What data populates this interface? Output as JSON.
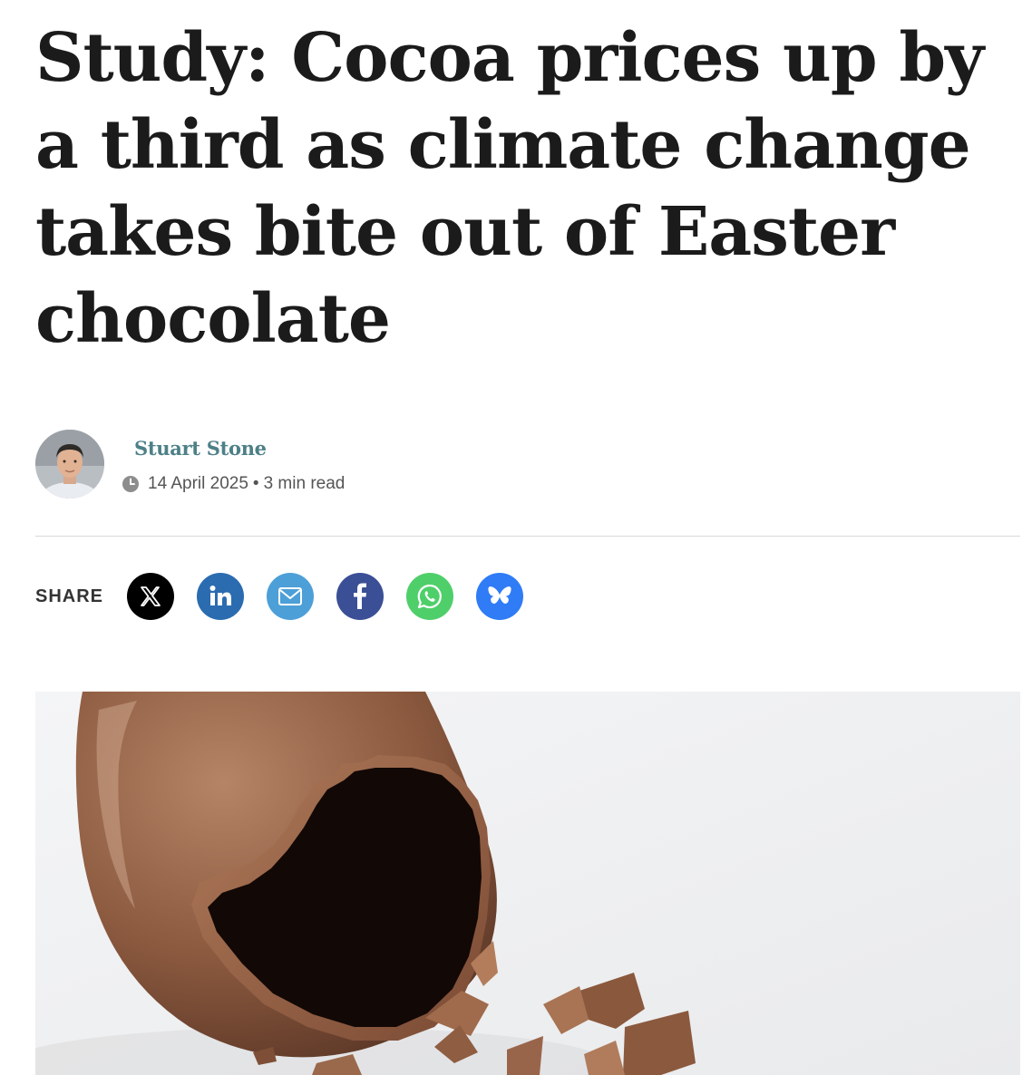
{
  "article": {
    "headline": "Study: Cocoa prices up by a third as climate change takes bite out of Easter chocolate"
  },
  "byline": {
    "author": "Stuart Stone",
    "date": "14 April 2025",
    "separator": "•",
    "read_time": "3 min read"
  },
  "share": {
    "label": "SHARE",
    "buttons": [
      {
        "network": "X",
        "icon": "x-icon",
        "color": "#000000"
      },
      {
        "network": "LinkedIn",
        "icon": "linkedin-icon",
        "color": "#2b6cb0"
      },
      {
        "network": "Email",
        "icon": "mail-icon",
        "color": "#4d9fd8"
      },
      {
        "network": "Facebook",
        "icon": "facebook-icon",
        "color": "#3b4f96"
      },
      {
        "network": "WhatsApp",
        "icon": "whatsapp-icon",
        "color": "#4fcf6a"
      },
      {
        "network": "Bluesky",
        "icon": "butterfly-icon",
        "color": "#2f7cf6"
      }
    ]
  },
  "colors": {
    "author_link": "#4d8087",
    "headline": "#1b1b1b"
  }
}
